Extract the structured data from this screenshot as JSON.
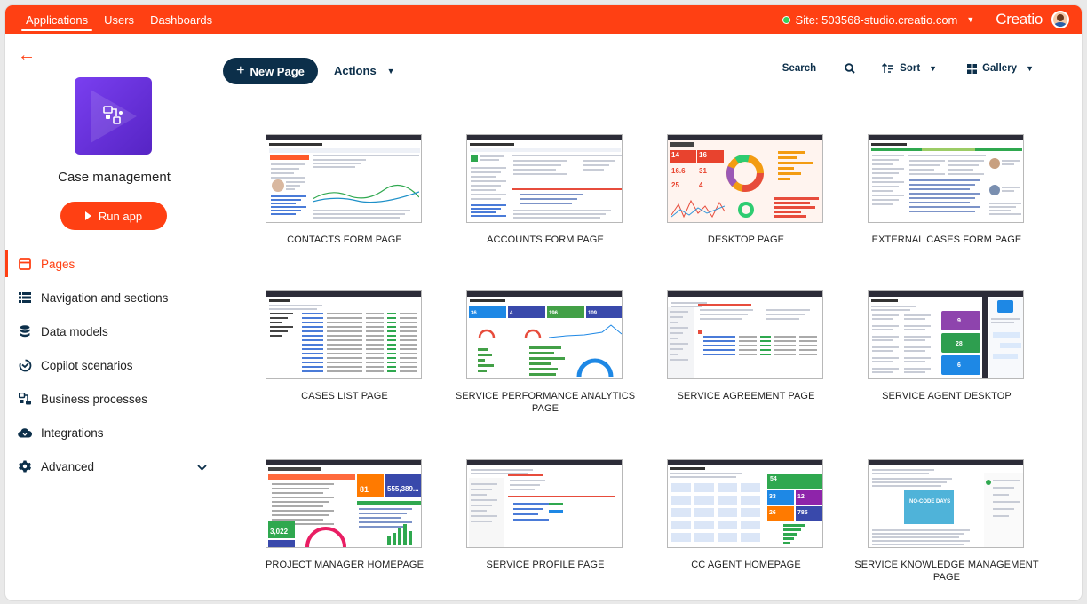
{
  "topbar": {
    "nav": [
      "Applications",
      "Users",
      "Dashboards"
    ],
    "site": "Site: 503568-studio.creatio.com",
    "brand": "Creatio"
  },
  "app": {
    "title": "Case management",
    "run_label": "Run app"
  },
  "menu": [
    {
      "label": "Pages",
      "icon": "pages-icon",
      "active": true
    },
    {
      "label": "Navigation and sections",
      "icon": "list-icon"
    },
    {
      "label": "Data models",
      "icon": "database-icon"
    },
    {
      "label": "Copilot scenarios",
      "icon": "copilot-icon"
    },
    {
      "label": "Business processes",
      "icon": "process-icon"
    },
    {
      "label": "Integrations",
      "icon": "cloud-icon"
    },
    {
      "label": "Advanced",
      "icon": "gear-icon",
      "expandable": true
    }
  ],
  "toolbar": {
    "new_page": "New Page",
    "actions": "Actions",
    "search": "Search",
    "sort": "Sort",
    "view": "Gallery"
  },
  "pages": [
    {
      "label": "CONTACTS FORM PAGE",
      "thumb": "form"
    },
    {
      "label": "ACCOUNTS FORM PAGE",
      "thumb": "form2"
    },
    {
      "label": "DESKTOP PAGE",
      "thumb": "desktop"
    },
    {
      "label": "EXTERNAL CASES FORM PAGE",
      "thumb": "ext"
    },
    {
      "label": "CASES LIST PAGE",
      "thumb": "list"
    },
    {
      "label": "SERVICE PERFORMANCE ANALYTICS PAGE",
      "thumb": "analytics"
    },
    {
      "label": "SERVICE AGREEMENT PAGE",
      "thumb": "agreement"
    },
    {
      "label": "SERVICE AGENT DESKTOP",
      "thumb": "agent"
    },
    {
      "label": "PROJECT MANAGER HOMEPAGE",
      "thumb": "pm"
    },
    {
      "label": "SERVICE PROFILE PAGE",
      "thumb": "profile"
    },
    {
      "label": "CC AGENT HOMEPAGE",
      "thumb": "cc"
    },
    {
      "label": "SERVICE KNOWLEDGE MANAGEMENT PAGE",
      "thumb": "knowledge"
    }
  ],
  "thumb_text": {
    "desktop": [
      "14",
      "16",
      "16.6",
      "31",
      "25",
      "4"
    ],
    "analytics": [
      "36",
      "4",
      "196",
      "109"
    ],
    "agent": [
      "9",
      "28",
      "6"
    ],
    "pm": [
      "81",
      "555,389...",
      "3,022"
    ],
    "cc": [
      "54",
      "33",
      "12",
      "26",
      "785"
    ],
    "knowledge": [
      "NO-CODE DAYS"
    ]
  },
  "colors": {
    "accent": "#ff4013",
    "primary_dark": "#0c2f4a",
    "app_tile": "#6a33e0",
    "online": "#35d05b"
  }
}
